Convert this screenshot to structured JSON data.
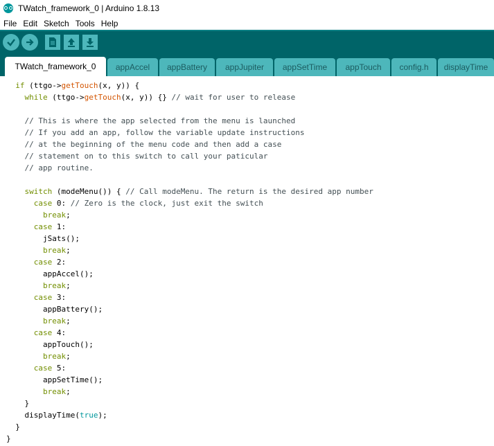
{
  "window": {
    "title": "TWatch_framework_0 | Arduino 1.8.13"
  },
  "menu": {
    "items": [
      "File",
      "Edit",
      "Sketch",
      "Tools",
      "Help"
    ]
  },
  "toolbar": {
    "buttons": [
      "verify-icon",
      "upload-icon",
      "new-icon",
      "open-icon",
      "save-icon"
    ]
  },
  "tabs": [
    {
      "label": "TWatch_framework_0",
      "active": true
    },
    {
      "label": "appAccel"
    },
    {
      "label": "appBattery"
    },
    {
      "label": "appJupiter"
    },
    {
      "label": "appSetTime"
    },
    {
      "label": "appTouch"
    },
    {
      "label": "config.h"
    },
    {
      "label": "displayTime"
    }
  ],
  "code": {
    "l1_kw": "if",
    "l1_a": " (ttgo->",
    "l1_fn": "getTouch",
    "l1_b": "(x, y)) {",
    "l2_kw": "while",
    "l2_a": " (ttgo->",
    "l2_fn": "getTouch",
    "l2_b": "(x, y)) {} ",
    "l2_cm": "// wait for user to release",
    "c1": "// This is where the app selected from the menu is launched",
    "c2": "// If you add an app, follow the variable update instructions",
    "c3": "// at the beginning of the menu code and then add a case",
    "c4": "// statement on to this switch to call your paticular",
    "c5": "// app routine.",
    "sw_kw": "switch",
    "sw_a": " (modeMenu()) { ",
    "sw_cm": "// Call modeMenu. The return is the desired app number",
    "case_kw": "case",
    "case0_a": " 0: ",
    "case0_cm": "// Zero is the clock, just exit the switch",
    "break_kw": "break",
    "semi": ";",
    "case1_a": " 1:",
    "call1": "jSats();",
    "case2_a": " 2:",
    "call2": "appAccel();",
    "case3_a": " 3:",
    "call3": "appBattery();",
    "case4_a": " 4:",
    "call4": "appTouch();",
    "case5_a": " 5:",
    "call5": "appSetTime();",
    "close_brace": "}",
    "dt_a": "displayTime(",
    "dt_lit": "true",
    "dt_b": ");"
  }
}
